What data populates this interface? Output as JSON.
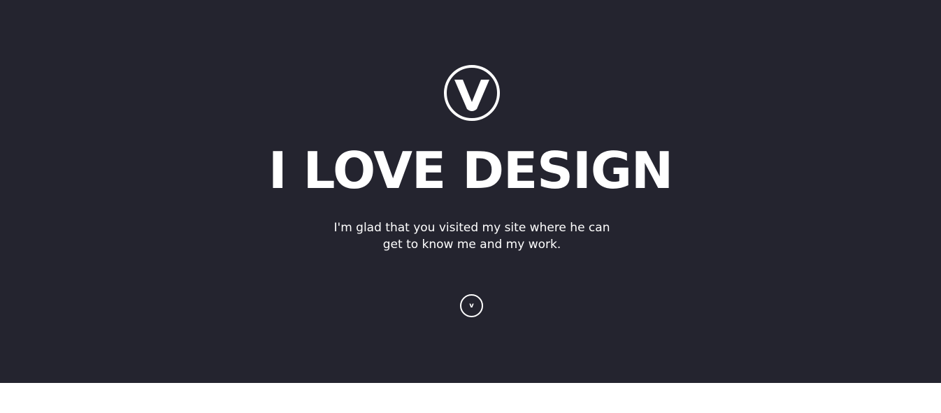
{
  "colors": {
    "hero_background": "#24242f",
    "text": "#ffffff",
    "page_background": "#ffffff"
  },
  "hero": {
    "logo_icon": "v-circle-logo-icon",
    "headline": "I LOVE DESIGN",
    "tagline": "I'm glad that you visited my site where he can get to know me and my work.",
    "scroll_button": {
      "icon": "chevron-down-icon",
      "label": "v"
    }
  }
}
